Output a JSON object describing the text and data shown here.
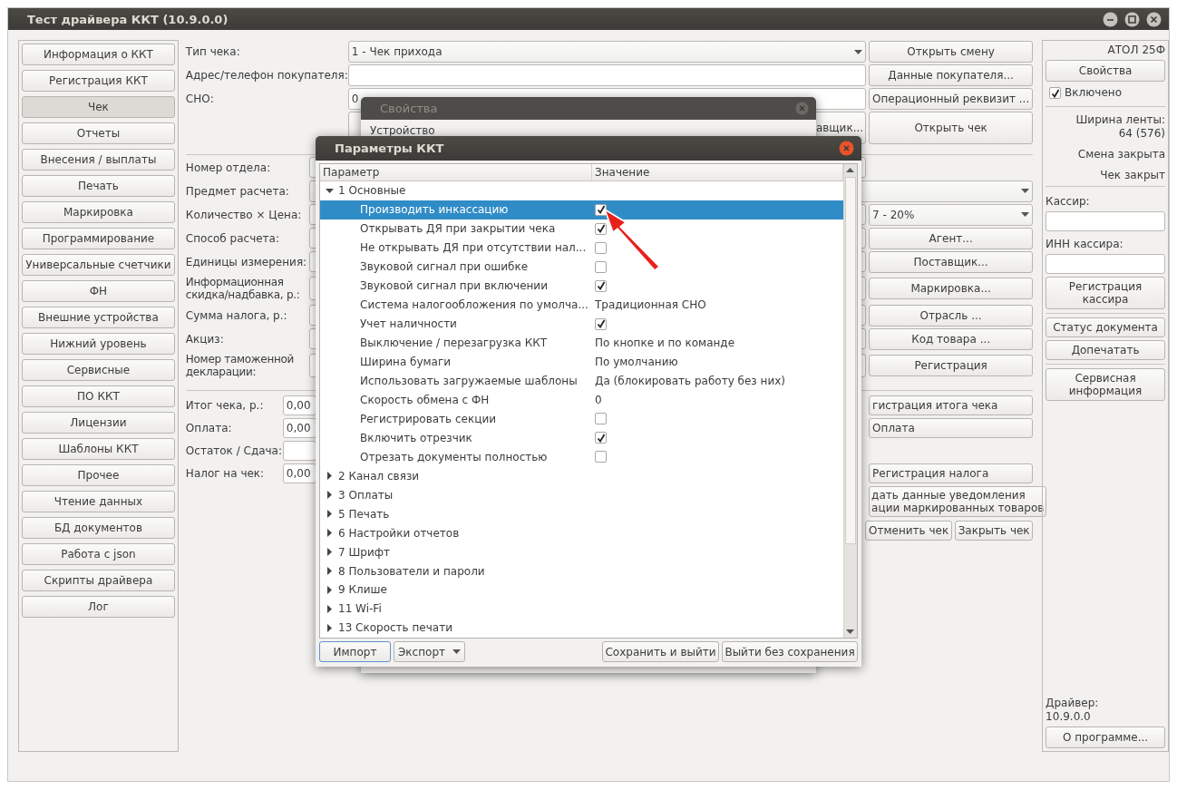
{
  "window": {
    "title": "Тест драйвера ККТ (10.9.0.0)"
  },
  "nav": [
    {
      "label": "Информация о ККТ",
      "selected": false
    },
    {
      "label": "Регистрация ККТ",
      "selected": false
    },
    {
      "label": "Чек",
      "selected": true
    },
    {
      "label": "Отчеты",
      "selected": false
    },
    {
      "label": "Внесения / выплаты",
      "selected": false
    },
    {
      "label": "Печать",
      "selected": false
    },
    {
      "label": "Маркировка",
      "selected": false
    },
    {
      "label": "Программирование",
      "selected": false
    },
    {
      "label": "Универсальные счетчики",
      "selected": false
    },
    {
      "label": "ФН",
      "selected": false
    },
    {
      "label": "Внешние устройства",
      "selected": false
    },
    {
      "label": "Нижний уровень",
      "selected": false
    },
    {
      "label": "Сервисные",
      "selected": false
    },
    {
      "label": "ПО ККТ",
      "selected": false
    },
    {
      "label": "Лицензии",
      "selected": false
    },
    {
      "label": "Шаблоны ККТ",
      "selected": false
    },
    {
      "label": "Прочее",
      "selected": false
    },
    {
      "label": "Чтение данных",
      "selected": false
    },
    {
      "label": "БД документов",
      "selected": false
    },
    {
      "label": "Работа с json",
      "selected": false
    },
    {
      "label": "Скрипты драйвера",
      "selected": false
    },
    {
      "label": "Лог",
      "selected": false
    }
  ],
  "receipt_type": {
    "label": "Тип чека:",
    "value": "1 - Чек прихода",
    "button": "Открыть смену"
  },
  "buyer_address": {
    "label": "Адрес/телефон покупателя:",
    "button": "Данные покупателя..."
  },
  "tax_system": {
    "label": "СНО:",
    "value": "0",
    "button": "Операционный реквизит ..."
  },
  "supplier_button_partial": "авщик...",
  "open_receipt_button": "Открыть чек",
  "item_fields": [
    {
      "label": "Номер отдела:",
      "kind": "input"
    },
    {
      "label": "Предмет расчета:",
      "kind": "wide_combo"
    },
    {
      "label": "Количество × Цена:",
      "kind": "input",
      "action": {
        "kind": "combo",
        "text": "7 - 20%"
      }
    },
    {
      "label": "Способ расчета:",
      "kind": "input",
      "action": {
        "kind": "button",
        "text": "Агент..."
      }
    },
    {
      "label": "Единицы измерения:",
      "kind": "input",
      "action": {
        "kind": "button",
        "text": "Поставщик..."
      }
    },
    {
      "label": "Информационная скидка/надбавка, р.:",
      "kind": "input",
      "action": {
        "kind": "button",
        "text": "Маркировка..."
      }
    },
    {
      "label": "Сумма налога, р.:",
      "kind": "input",
      "action": {
        "kind": "button",
        "text": "Отрасль ..."
      }
    },
    {
      "label": "Акциз:",
      "kind": "input",
      "action": {
        "kind": "button",
        "text": "Код товара ..."
      }
    },
    {
      "label": "Номер таможенной декларации:",
      "kind": "input",
      "action": {
        "kind": "button",
        "text": "Регистрация"
      }
    }
  ],
  "totals": [
    {
      "label": "Итог чека, р.:",
      "value": "0,00",
      "action": "гистрация итога чека"
    },
    {
      "label": "Оплата:",
      "value": "0,00",
      "action": "Оплата"
    },
    {
      "label": "Остаток / Сдача:"
    },
    {
      "label": "Налог на чек:",
      "value": "0,00",
      "action": "Регистрация налога"
    }
  ],
  "notify_button_lines": [
    "дать данные уведомления",
    "ации маркированных товаров"
  ],
  "cancel_receipt_button": "Отменить чек",
  "close_receipt_button": "Закрыть чек",
  "device_panel": {
    "model": "АТОЛ 25Ф",
    "properties_button": "Свойства",
    "enabled": {
      "label": "Включено",
      "checked": true
    },
    "tape_width_lines": [
      "Ширина ленты:",
      "64 (576)"
    ],
    "shift_status": "Смена закрыта",
    "receipt_status": "Чек закрыт",
    "cashier_label": "Кассир:",
    "cashier_inn_label": "ИНН кассира:",
    "register_cashier_button": "Регистрация кассира",
    "document_status_button": "Статус документа",
    "reprint_button": "Допечатать",
    "service_info_button": "Сервисная информация",
    "driver_lines": [
      "Драйвер:",
      "10.9.0.0"
    ],
    "about_button": "О программе..."
  },
  "properties_dialog": {
    "title": "Свойства",
    "section": "Устройство"
  },
  "settings_dialog": {
    "title": "Параметры ККТ",
    "columns": [
      "Параметр",
      "Значение"
    ],
    "groups": [
      {
        "label": "1 Основные",
        "expanded": true,
        "selected": false,
        "children": [
          {
            "label": "Производить инкассацию",
            "kind": "check",
            "checked": true,
            "selected": true
          },
          {
            "label": "Открывать ДЯ при закрытии чека",
            "kind": "check",
            "checked": true,
            "selected": false
          },
          {
            "label": "Не открывать ДЯ при отсутствии нал...",
            "kind": "check",
            "checked": false,
            "selected": false
          },
          {
            "label": "Звуковой сигнал при ошибке",
            "kind": "check",
            "checked": false,
            "selected": false
          },
          {
            "label": "Звуковой сигнал при включении",
            "kind": "check",
            "checked": true,
            "selected": false
          },
          {
            "label": "Система налогообложения по умолча...",
            "kind": "text",
            "value": "Традиционная СНО",
            "selected": false
          },
          {
            "label": "Учет наличности",
            "kind": "check",
            "checked": true,
            "selected": false
          },
          {
            "label": "Выключение / перезагрузка ККТ",
            "kind": "text",
            "value": "По кнопке и по команде",
            "selected": false
          },
          {
            "label": "Ширина бумаги",
            "kind": "text",
            "value": "По умолчанию",
            "selected": false
          },
          {
            "label": "Использовать загружаемые шаблоны",
            "kind": "text",
            "value": "Да (блокировать работу без них)",
            "selected": false
          },
          {
            "label": "Скорость обмена с ФН",
            "kind": "text",
            "value": "0",
            "selected": false
          },
          {
            "label": "Регистрировать секции",
            "kind": "check",
            "checked": false,
            "selected": false
          },
          {
            "label": "Включить отрезчик",
            "kind": "check",
            "checked": true,
            "selected": false
          },
          {
            "label": "Отрезать документы полностью",
            "kind": "check",
            "checked": false,
            "selected": false
          }
        ]
      },
      {
        "label": "2 Канал связи",
        "expanded": false,
        "selected": false
      },
      {
        "label": "3 Оплаты",
        "expanded": false,
        "selected": false
      },
      {
        "label": "5 Печать",
        "expanded": false,
        "selected": false
      },
      {
        "label": "6 Настройки отчетов",
        "expanded": false,
        "selected": false
      },
      {
        "label": "7 Шрифт",
        "expanded": false,
        "selected": false
      },
      {
        "label": "8 Пользователи и пароли",
        "expanded": false,
        "selected": false
      },
      {
        "label": "9 Клише",
        "expanded": false,
        "selected": false
      },
      {
        "label": "11 Wi-Fi",
        "expanded": false,
        "selected": false
      },
      {
        "label": "13 Скорость печати",
        "expanded": false,
        "selected": false
      }
    ],
    "import_button": "Импорт",
    "export_button": "Экспорт",
    "save_button": "Сохранить и выйти",
    "discard_button": "Выйти без сохранения"
  }
}
